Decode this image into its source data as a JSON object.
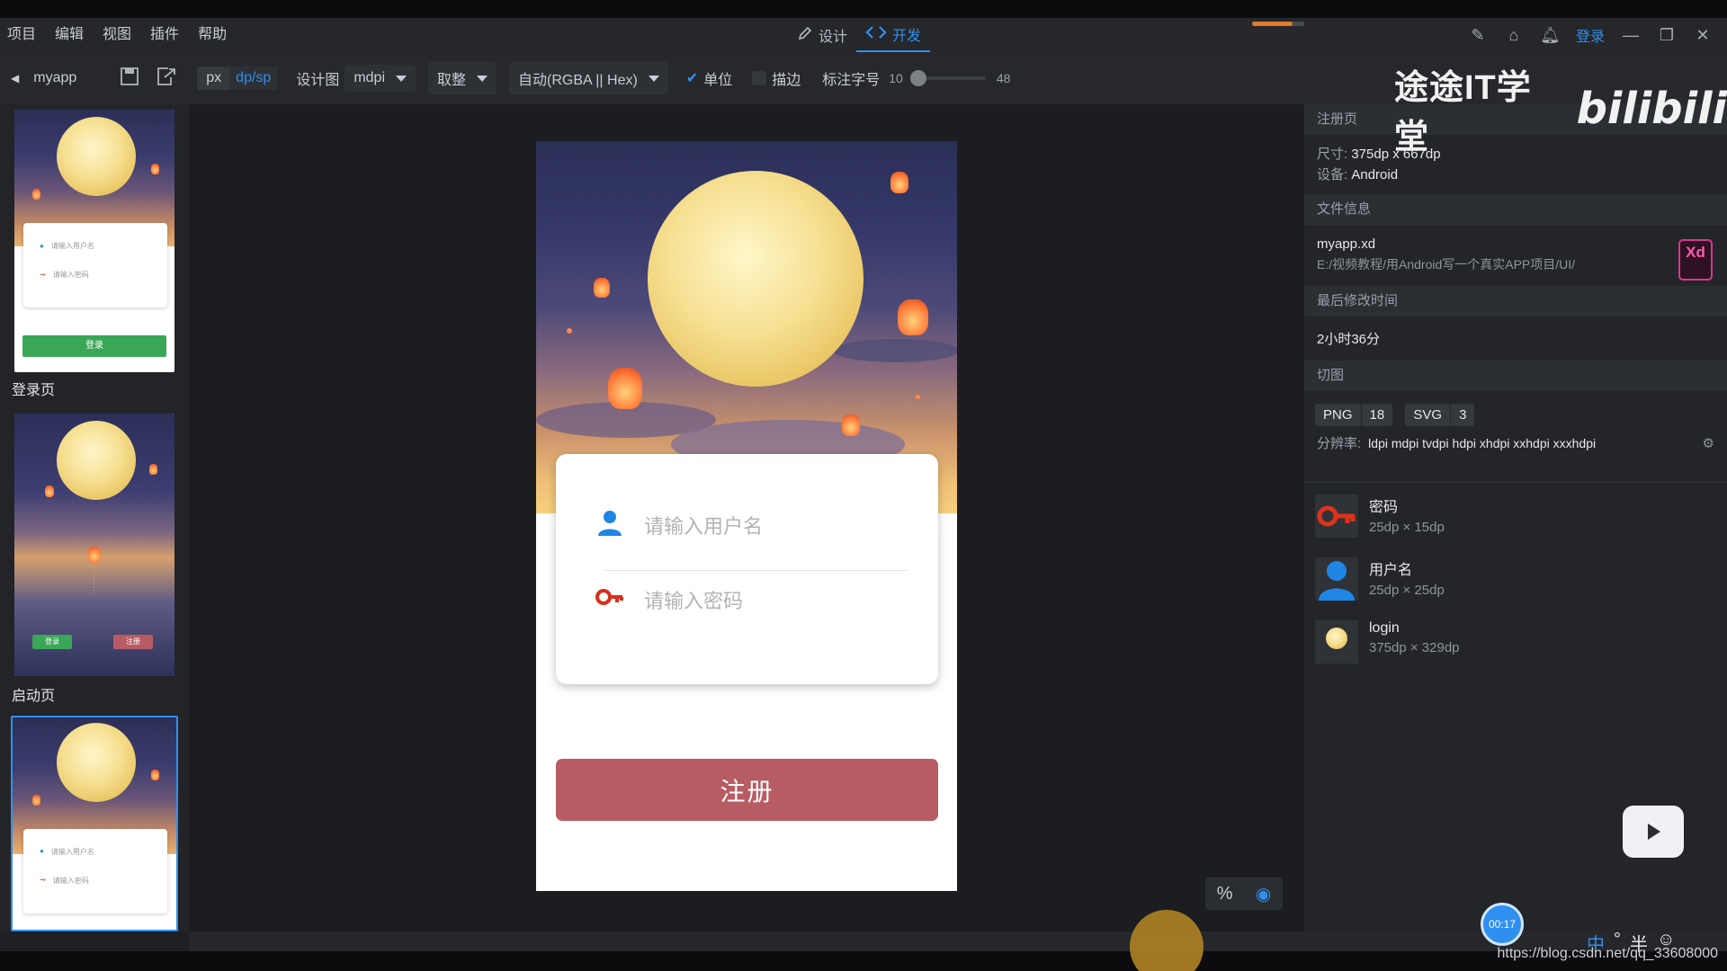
{
  "menubar": {
    "items": [
      "项目",
      "编辑",
      "视图",
      "插件",
      "帮助"
    ],
    "mode_tabs": [
      {
        "label": "设计",
        "active": false
      },
      {
        "label": "开发",
        "active": true
      }
    ],
    "login_label": "登录"
  },
  "toolbar": {
    "back_label": "myapp",
    "unit_px": "px",
    "unit_dp": "dp/sp",
    "design_label": "设计图",
    "density_value": "mdpi",
    "rounding_value": "取整",
    "color_format_value": "自动(RGBA || Hex)",
    "unit_check_label": "单位",
    "unit_checked": true,
    "stroke_check_label": "描边",
    "stroke_checked": false,
    "font_size_label": "标注字号",
    "font_size_min": "10",
    "font_size_max": "48",
    "font_size_level": 0.0
  },
  "screens": [
    {
      "label": "登录页",
      "username_placeholder": "请输入用户名",
      "password_placeholder": "请输入密码",
      "button_label": "登录"
    },
    {
      "label": "启动页",
      "left_button": "登录",
      "right_button": "注册"
    },
    {
      "label": "",
      "username_placeholder": "请输入用户名",
      "password_placeholder": "请输入密码",
      "selected": true
    }
  ],
  "artboard": {
    "username_placeholder": "请输入用户名",
    "password_placeholder": "请输入密码",
    "register_label": "注册",
    "accent_color": "#b85c63"
  },
  "panel": {
    "page_title": "注册页",
    "size_label": "尺寸:",
    "size_value": "375dp x 667dp",
    "device_label": "设备:",
    "device_value": "Android",
    "file_info_title": "文件信息",
    "file_name": "myapp.xd",
    "file_path": "E:/视频教程/用Android写一个真实APP项目/UI/",
    "modified_title": "最后修改时间",
    "modified_value": "2小时36分",
    "slices_title": "切图",
    "png_label": "PNG",
    "png_count": "18",
    "svg_label": "SVG",
    "svg_count": "3",
    "resolution_label": "分辨率:",
    "resolution_value": "ldpi mdpi tvdpi hdpi xhdpi xxhdpi xxxhdpi",
    "xd_badge": "Xd",
    "assets": [
      {
        "name": "密码",
        "size": "25dp × 15dp",
        "icon": "key-icon"
      },
      {
        "name": "用户名",
        "size": "25dp × 25dp",
        "icon": "user-icon"
      },
      {
        "name": "login",
        "size": "375dp × 329dp",
        "icon": "image-thumbnail"
      }
    ]
  },
  "overlay": {
    "watermark_text": "途途IT学堂",
    "bilibili_text": "bilibili",
    "timer": "00:17",
    "url": "https://blog.csdn.net/qq_33608000",
    "ime": [
      "中",
      "°",
      "半",
      "☺"
    ]
  },
  "colors": {
    "accent_blue": "#2f8ff0",
    "brand_pink": "#d23c8a"
  }
}
